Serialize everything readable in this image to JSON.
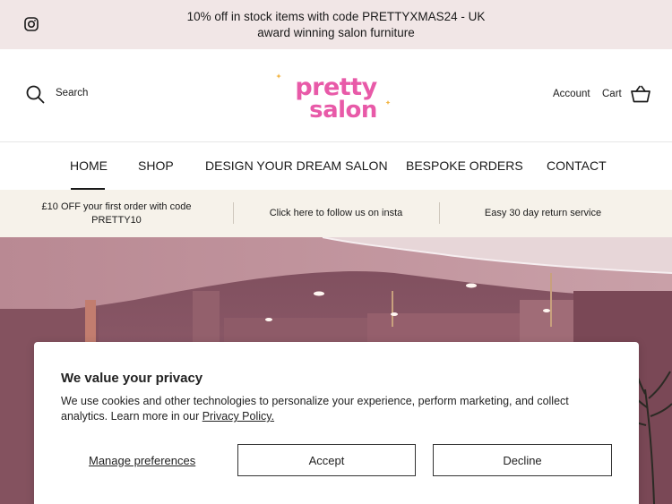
{
  "announcement": {
    "line1": "10% off in stock items with code PRETTYXMAS24 - UK",
    "line2": "award winning salon furniture",
    "instagram_icon": "instagram-icon"
  },
  "header": {
    "search_label": "Search",
    "logo_line1": "pretty",
    "logo_line2": "salon",
    "account_label": "Account",
    "cart_label": "Cart",
    "brand_color": "#e85aa8"
  },
  "nav": {
    "items": [
      {
        "label": "HOME",
        "active": true
      },
      {
        "label": "SHOP"
      },
      {
        "label": "DESIGN YOUR DREAM SALON"
      },
      {
        "label": "BESPOKE ORDERS"
      },
      {
        "label": "CONTACT"
      }
    ]
  },
  "usp": {
    "items": [
      {
        "line1": "£10 OFF your first order with code",
        "line2": "PRETTY10"
      },
      {
        "line1": "Click here to follow us on insta"
      },
      {
        "line1": "Easy 30 day return service"
      }
    ]
  },
  "cookie": {
    "title": "We value your privacy",
    "body": "We use cookies and other technologies to personalize your experience, perform marketing, and collect analytics. Learn more in our ",
    "policy_link": "Privacy Policy.",
    "manage_label": "Manage preferences",
    "accept_label": "Accept",
    "decline_label": "Decline"
  }
}
